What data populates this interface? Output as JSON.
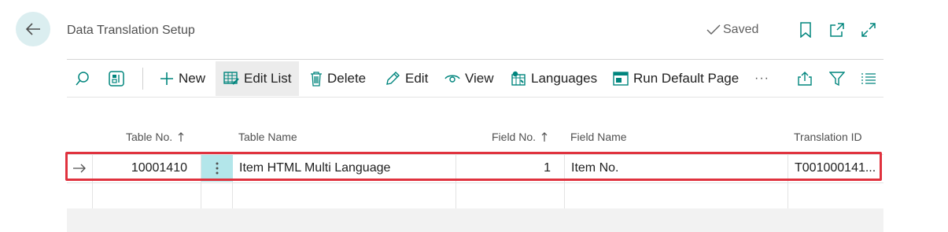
{
  "header": {
    "title": "Data Translation Setup",
    "saved_label": "Saved"
  },
  "toolbar": {
    "new_label": "New",
    "edit_list_label": "Edit List",
    "delete_label": "Delete",
    "edit_label": "Edit",
    "view_label": "View",
    "languages_label": "Languages",
    "run_default_page_label": "Run Default Page",
    "more_label": "···"
  },
  "table": {
    "columns": {
      "table_no": "Table No.",
      "table_name": "Table Name",
      "field_no": "Field No.",
      "field_name": "Field Name",
      "translation_id": "Translation ID"
    },
    "rows": [
      {
        "table_no": "10001410",
        "table_name": "Item HTML Multi Language",
        "field_no": "1",
        "field_name": "Item No.",
        "translation_id": "T001000141..."
      }
    ]
  },
  "colors": {
    "accent": "#00857d",
    "selected_cell": "#b3e6ea",
    "highlight": "#e0323e"
  }
}
